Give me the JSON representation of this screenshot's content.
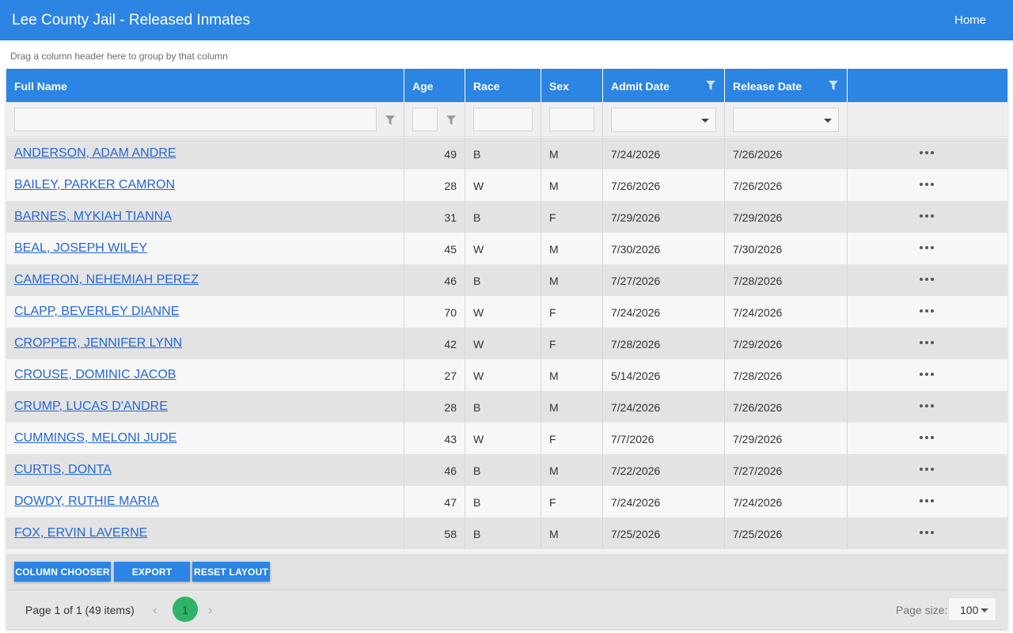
{
  "app": {
    "title": "Lee County Jail - Released Inmates",
    "nav_home": "Home"
  },
  "grid": {
    "group_hint": "Drag a column header here to group by that column",
    "columns": [
      "Full Name",
      "Age",
      "Race",
      "Sex",
      "Admit Date",
      "Release Date"
    ],
    "rows": [
      {
        "name": "ANDERSON, ADAM ANDRE",
        "age": "49",
        "race": "B",
        "sex": "M",
        "admit": "7/24/2026",
        "release": "7/26/2026"
      },
      {
        "name": "BAILEY, PARKER CAMRON",
        "age": "28",
        "race": "W",
        "sex": "M",
        "admit": "7/26/2026",
        "release": "7/26/2026"
      },
      {
        "name": "BARNES, MYKIAH TIANNA",
        "age": "31",
        "race": "B",
        "sex": "F",
        "admit": "7/29/2026",
        "release": "7/29/2026"
      },
      {
        "name": "BEAL, JOSEPH WILEY",
        "age": "45",
        "race": "W",
        "sex": "M",
        "admit": "7/30/2026",
        "release": "7/30/2026"
      },
      {
        "name": "CAMERON, NEHEMIAH PEREZ",
        "age": "46",
        "race": "B",
        "sex": "M",
        "admit": "7/27/2026",
        "release": "7/28/2026"
      },
      {
        "name": "CLAPP, BEVERLEY DIANNE",
        "age": "70",
        "race": "W",
        "sex": "F",
        "admit": "7/24/2026",
        "release": "7/24/2026"
      },
      {
        "name": "CROPPER, JENNIFER LYNN",
        "age": "42",
        "race": "W",
        "sex": "F",
        "admit": "7/28/2026",
        "release": "7/29/2026"
      },
      {
        "name": "CROUSE, DOMINIC JACOB",
        "age": "27",
        "race": "W",
        "sex": "M",
        "admit": "5/14/2026",
        "release": "7/28/2026"
      },
      {
        "name": "CRUMP, LUCAS D'ANDRE",
        "age": "28",
        "race": "B",
        "sex": "M",
        "admit": "7/24/2026",
        "release": "7/26/2026"
      },
      {
        "name": "CUMMINGS, MELONI JUDE",
        "age": "43",
        "race": "W",
        "sex": "F",
        "admit": "7/7/2026",
        "release": "7/29/2026"
      },
      {
        "name": "CURTIS, DONTA",
        "age": "46",
        "race": "B",
        "sex": "M",
        "admit": "7/22/2026",
        "release": "7/27/2026"
      },
      {
        "name": "DOWDY, RUTHIE MARIA",
        "age": "47",
        "race": "B",
        "sex": "F",
        "admit": "7/24/2026",
        "release": "7/24/2026"
      },
      {
        "name": "FOX, ERVIN LAVERNE",
        "age": "58",
        "race": "B",
        "sex": "M",
        "admit": "7/25/2026",
        "release": "7/25/2026"
      }
    ]
  },
  "toolbar": {
    "column_chooser": "COLUMN CHOOSER",
    "export": "EXPORT",
    "reset_layout": "RESET LAYOUT"
  },
  "pager": {
    "info": "Page 1 of 1 (49 items)",
    "current_page": "1",
    "page_size_label": "Page size:",
    "page_size": "100"
  },
  "colors": {
    "header_blue": "#2c84e3",
    "link_blue": "#2567d6",
    "pager_active": "#2fb36b"
  }
}
